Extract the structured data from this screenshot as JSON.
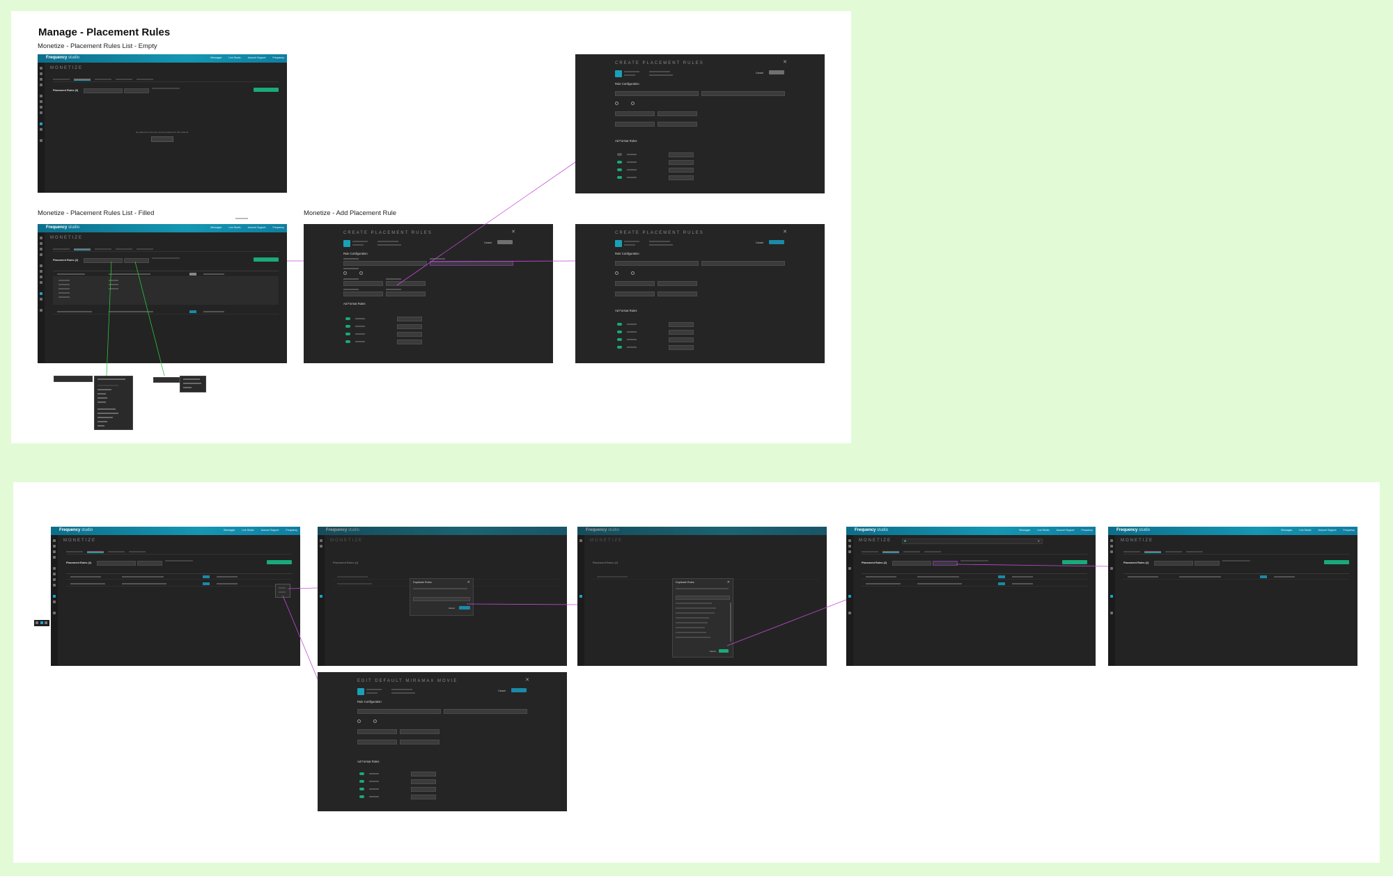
{
  "page_title": "Manage - Placement Rules",
  "frame_labels": {
    "list_empty": "Monetize - Placement Rules List - Empty",
    "list_filled": "Monetize - Placement Rules List - Filled",
    "add_rule": "Monetize - Add Placement Rule"
  },
  "app": {
    "logo": "Frequency",
    "logo_suffix": "studio",
    "section": "MONETIZE",
    "nav": [
      "Messages",
      "Live Studio",
      "Account Support",
      "Frequency"
    ],
    "list_title": "Placement Rules",
    "filled_count": "(2)",
    "empty_count": "(0)",
    "empty_message": "No placement rules are currently defined for this channel.",
    "empty_button": "Add Placement Rules"
  },
  "create_modal": {
    "title": "CREATE PLACEMENT RULES",
    "cancel": "Cancel",
    "save": "Save Rule",
    "section_config": "Rule Configuration",
    "section_formats": "Ad Format Rules",
    "formats": [
      "1 Ad Unit",
      "Rolled Ads",
      "Fixed Interstitial",
      "Mid-Roll"
    ]
  },
  "edit_modal": {
    "title": "EDIT DEFAULT MIRAMAX MOVIE"
  },
  "duplicate_dialog": {
    "title": "Duplicate Rules",
    "cancel": "Cancel",
    "confirm": "Duplicate"
  },
  "colors": {
    "canvas": "#e2fbd6",
    "board": "#ffffff",
    "screen_bg": "#232323",
    "header_teal": "#1497b3",
    "accent_green": "#1aa97a",
    "accent_blue": "#1a8aa8",
    "connector_purple": "#c64bd8",
    "connector_green": "#2ec43a"
  }
}
